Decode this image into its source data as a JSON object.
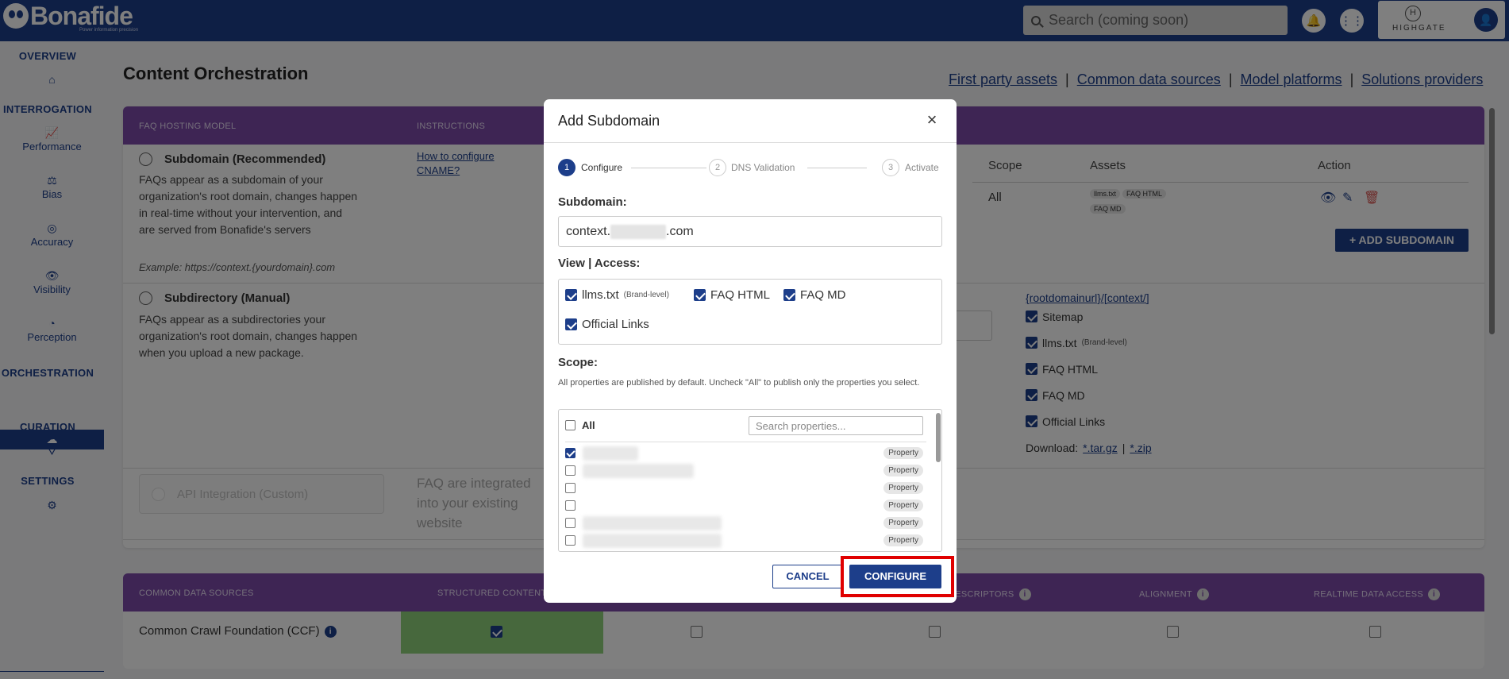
{
  "header": {
    "brand": "Bonafide",
    "tagline": "Power information precision",
    "search_placeholder": "Search (coming soon)",
    "account_name": "HIGHGATE",
    "account_mark": "H"
  },
  "sidebar": {
    "overview": "OVERVIEW",
    "interrogation": "INTERROGATION",
    "items": [
      {
        "label": "Performance"
      },
      {
        "label": "Bias"
      },
      {
        "label": "Accuracy"
      },
      {
        "label": "Visibility"
      },
      {
        "label": "Perception"
      }
    ],
    "orchestration": "ORCHESTRATION",
    "curation": "CURATION",
    "settings": "SETTINGS"
  },
  "page": {
    "title": "Content Orchestration",
    "links": [
      "First party assets",
      "Common data sources",
      "Model platforms",
      "Solutions providers"
    ],
    "link_sep": "|"
  },
  "hosting_table": {
    "headers": [
      "FAQ HOSTING MODEL",
      "INSTRUCTIONS"
    ],
    "subdomain": {
      "title": "Subdomain (Recommended)",
      "desc": "FAQs appear as a subdomain of your organization's root domain, changes happen in real-time without your intervention, and are served from Bonafide's servers",
      "example": "Example: https://context.{yourdomain}.com",
      "instruction_link": "How to configure CNAME?"
    },
    "sub_cols": [
      "Scope",
      "Assets",
      "Action"
    ],
    "sub_row": {
      "scope": "All",
      "assets": [
        "llms.txt",
        "FAQ HTML",
        "FAQ MD"
      ]
    },
    "add_button": "+ ADD SUBDOMAIN",
    "subdirectory": {
      "title": "Subdirectory (Manual)",
      "desc": "FAQs appear as a subdirectories your organization's root domain, changes happen when you upload a new package.",
      "path_link": "{rootdomainurl}/[context/]",
      "checks": [
        {
          "label": "Sitemap",
          "note": ""
        },
        {
          "label": "llms.txt",
          "note": "(Brand-level)"
        },
        {
          "label": "FAQ HTML",
          "note": ""
        },
        {
          "label": "FAQ MD",
          "note": ""
        },
        {
          "label": "Official Links",
          "note": ""
        }
      ],
      "download_label": "Download:",
      "download_links": [
        "*.tar.gz",
        "*.zip"
      ],
      "download_sep": "|"
    },
    "api": {
      "title": "API Integration (Custom)",
      "desc": "FAQ are integrated into your existing website"
    }
  },
  "sources_table": {
    "headers": [
      "COMMON DATA SOURCES",
      "STRUCTURED CONTENT",
      "DESCRIPTORS",
      "ALIGNMENT",
      "REALTIME DATA ACCESS"
    ],
    "rows": [
      {
        "name": "Common Crawl Foundation (CCF)"
      }
    ]
  },
  "modal": {
    "title": "Add Subdomain",
    "steps": [
      {
        "num": "1",
        "label": "Configure"
      },
      {
        "num": "2",
        "label": "DNS Validation"
      },
      {
        "num": "3",
        "label": "Activate"
      }
    ],
    "subdomain_label": "Subdomain:",
    "subdomain_prefix": "context.",
    "subdomain_suffix": ".com",
    "access_label": "View | Access:",
    "access": [
      {
        "label": "llms.txt",
        "note": "(Brand-level)",
        "checked": true
      },
      {
        "label": "FAQ HTML",
        "note": "",
        "checked": true
      },
      {
        "label": "FAQ MD",
        "note": "",
        "checked": true
      },
      {
        "label": "Official Links",
        "note": "",
        "checked": true
      }
    ],
    "scope_label": "Scope:",
    "scope_help": "All properties are published by default. Uncheck \"All\" to publish only the properties you select.",
    "scope_all": "All",
    "scope_search_placeholder": "Search properties...",
    "property_tag": "Property",
    "cancel": "CANCEL",
    "configure": "CONFIGURE"
  }
}
